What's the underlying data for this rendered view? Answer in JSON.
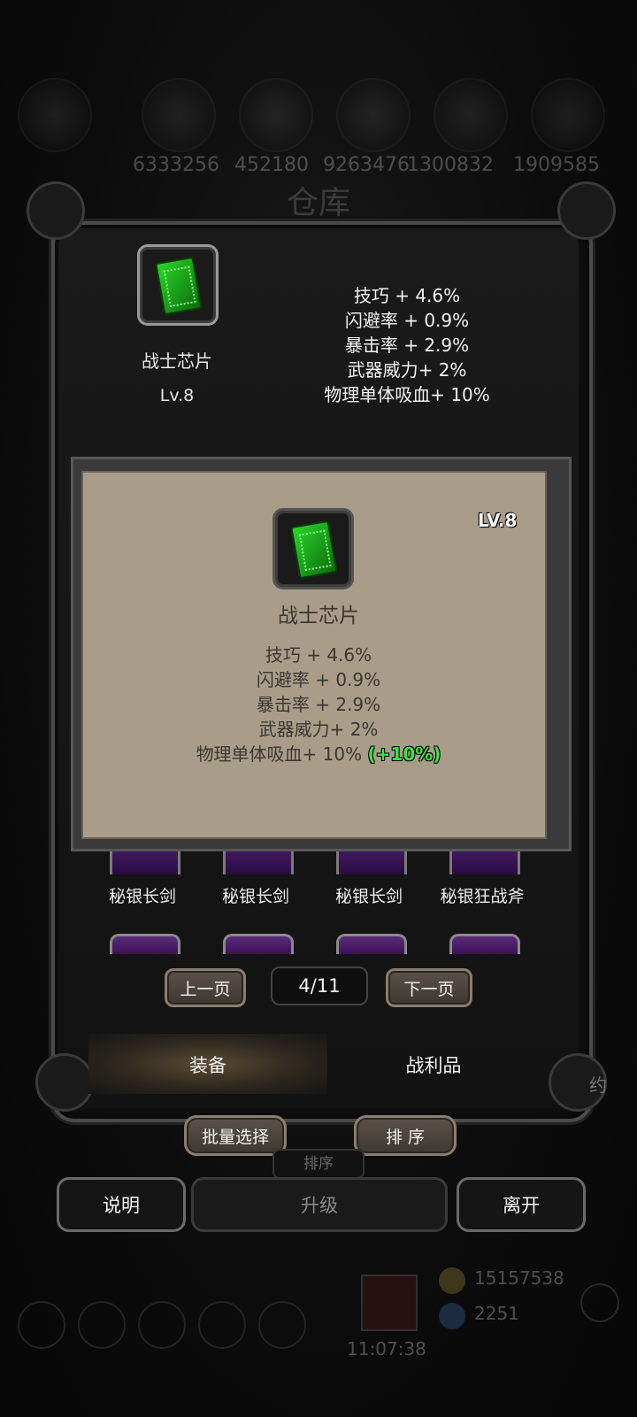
{
  "resources": {
    "values": [
      "6333256",
      "452180",
      "9263476",
      "1300832",
      "1909585"
    ]
  },
  "screen_title": "仓库",
  "selected_item": {
    "icon": "green-chip-icon",
    "name": "战士芯片",
    "level": "Lv.8",
    "stats": [
      "技巧 + 4.6%",
      "闪避率 + 0.9%",
      "暴击率 + 2.9%",
      "武器威力+ 2%",
      "物理单体吸血+ 10%"
    ]
  },
  "tooltip": {
    "level": "LV.8",
    "name": "战士芯片",
    "stats": [
      "技巧 + 4.6%",
      "闪避率 + 0.9%",
      "暴击率 + 2.9%",
      "武器威力+ 2%",
      "物理单体吸血+ 10%"
    ],
    "bonus": "(+10%)",
    "bonus_color": "#3fe43f"
  },
  "inventory": {
    "row1": [
      "秘银长剑",
      "秘银长剑",
      "秘银长剑",
      "秘银狂战斧"
    ]
  },
  "pagination": {
    "prev": "上一页",
    "page": "4/11",
    "next": "下一页"
  },
  "tabs": {
    "equipment": "装备",
    "loot": "战利品"
  },
  "actions": {
    "batch_select": "批量选择",
    "sort": "排 序",
    "sort_bg": "排序",
    "side_text": "约"
  },
  "bottom": {
    "help": "说明",
    "upgrade": "升级",
    "leave": "离开"
  },
  "footer": {
    "gold": "15157538",
    "gems": "2251",
    "time": "11:07:38"
  }
}
